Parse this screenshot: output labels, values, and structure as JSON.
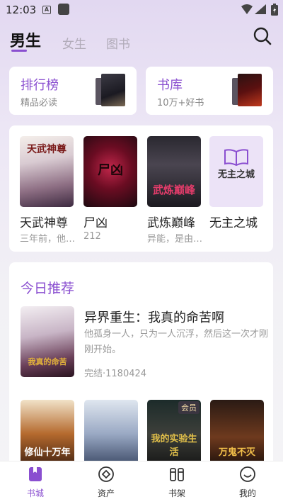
{
  "status": {
    "time": "12:03",
    "notif_icon_letter": "A"
  },
  "tabs": [
    {
      "label": "男生",
      "active": true
    },
    {
      "label": "女生",
      "active": false
    },
    {
      "label": "图书",
      "active": false
    }
  ],
  "quick_links": {
    "rank": {
      "title": "排行榜",
      "subtitle": "精品必读"
    },
    "library": {
      "title": "书库",
      "subtitle": "10万+好书"
    }
  },
  "shelf": [
    {
      "title": "天武神尊",
      "subtitle": "三年前，他…",
      "cover_text": "天武神尊"
    },
    {
      "title": "尸凶",
      "subtitle": "212",
      "cover_text": "尸凶"
    },
    {
      "title": "武炼巅峰",
      "subtitle": "异能，是由…",
      "cover_text": "武炼巅峰"
    },
    {
      "title": "无主之城",
      "subtitle": "",
      "cover_text": "无主之城"
    }
  ],
  "recommend": {
    "section_title": "今日推荐",
    "featured": {
      "title": "异界重生：我真的命苦啊",
      "description": "他孤身一人，只为一人沉浮，然后这一次才刚刚开始。",
      "meta": "完结·1180424",
      "cover_text": "我真的命苦"
    },
    "row": [
      {
        "cover_text": "修仙十万年",
        "badge": ""
      },
      {
        "cover_text": "",
        "badge": ""
      },
      {
        "cover_text": "我的实验生活",
        "badge": "会员"
      },
      {
        "cover_text": "万鬼不灭",
        "badge": ""
      }
    ]
  },
  "bottom_nav": [
    {
      "label": "书城",
      "icon": "bookstore-icon",
      "active": true
    },
    {
      "label": "资产",
      "icon": "asset-icon",
      "active": false
    },
    {
      "label": "书架",
      "icon": "bookshelf-icon",
      "active": false
    },
    {
      "label": "我的",
      "icon": "profile-icon",
      "active": false
    }
  ],
  "colors": {
    "accent": "#8a4fd0",
    "muted": "#999999",
    "tab_inactive": "#b1abb8"
  }
}
